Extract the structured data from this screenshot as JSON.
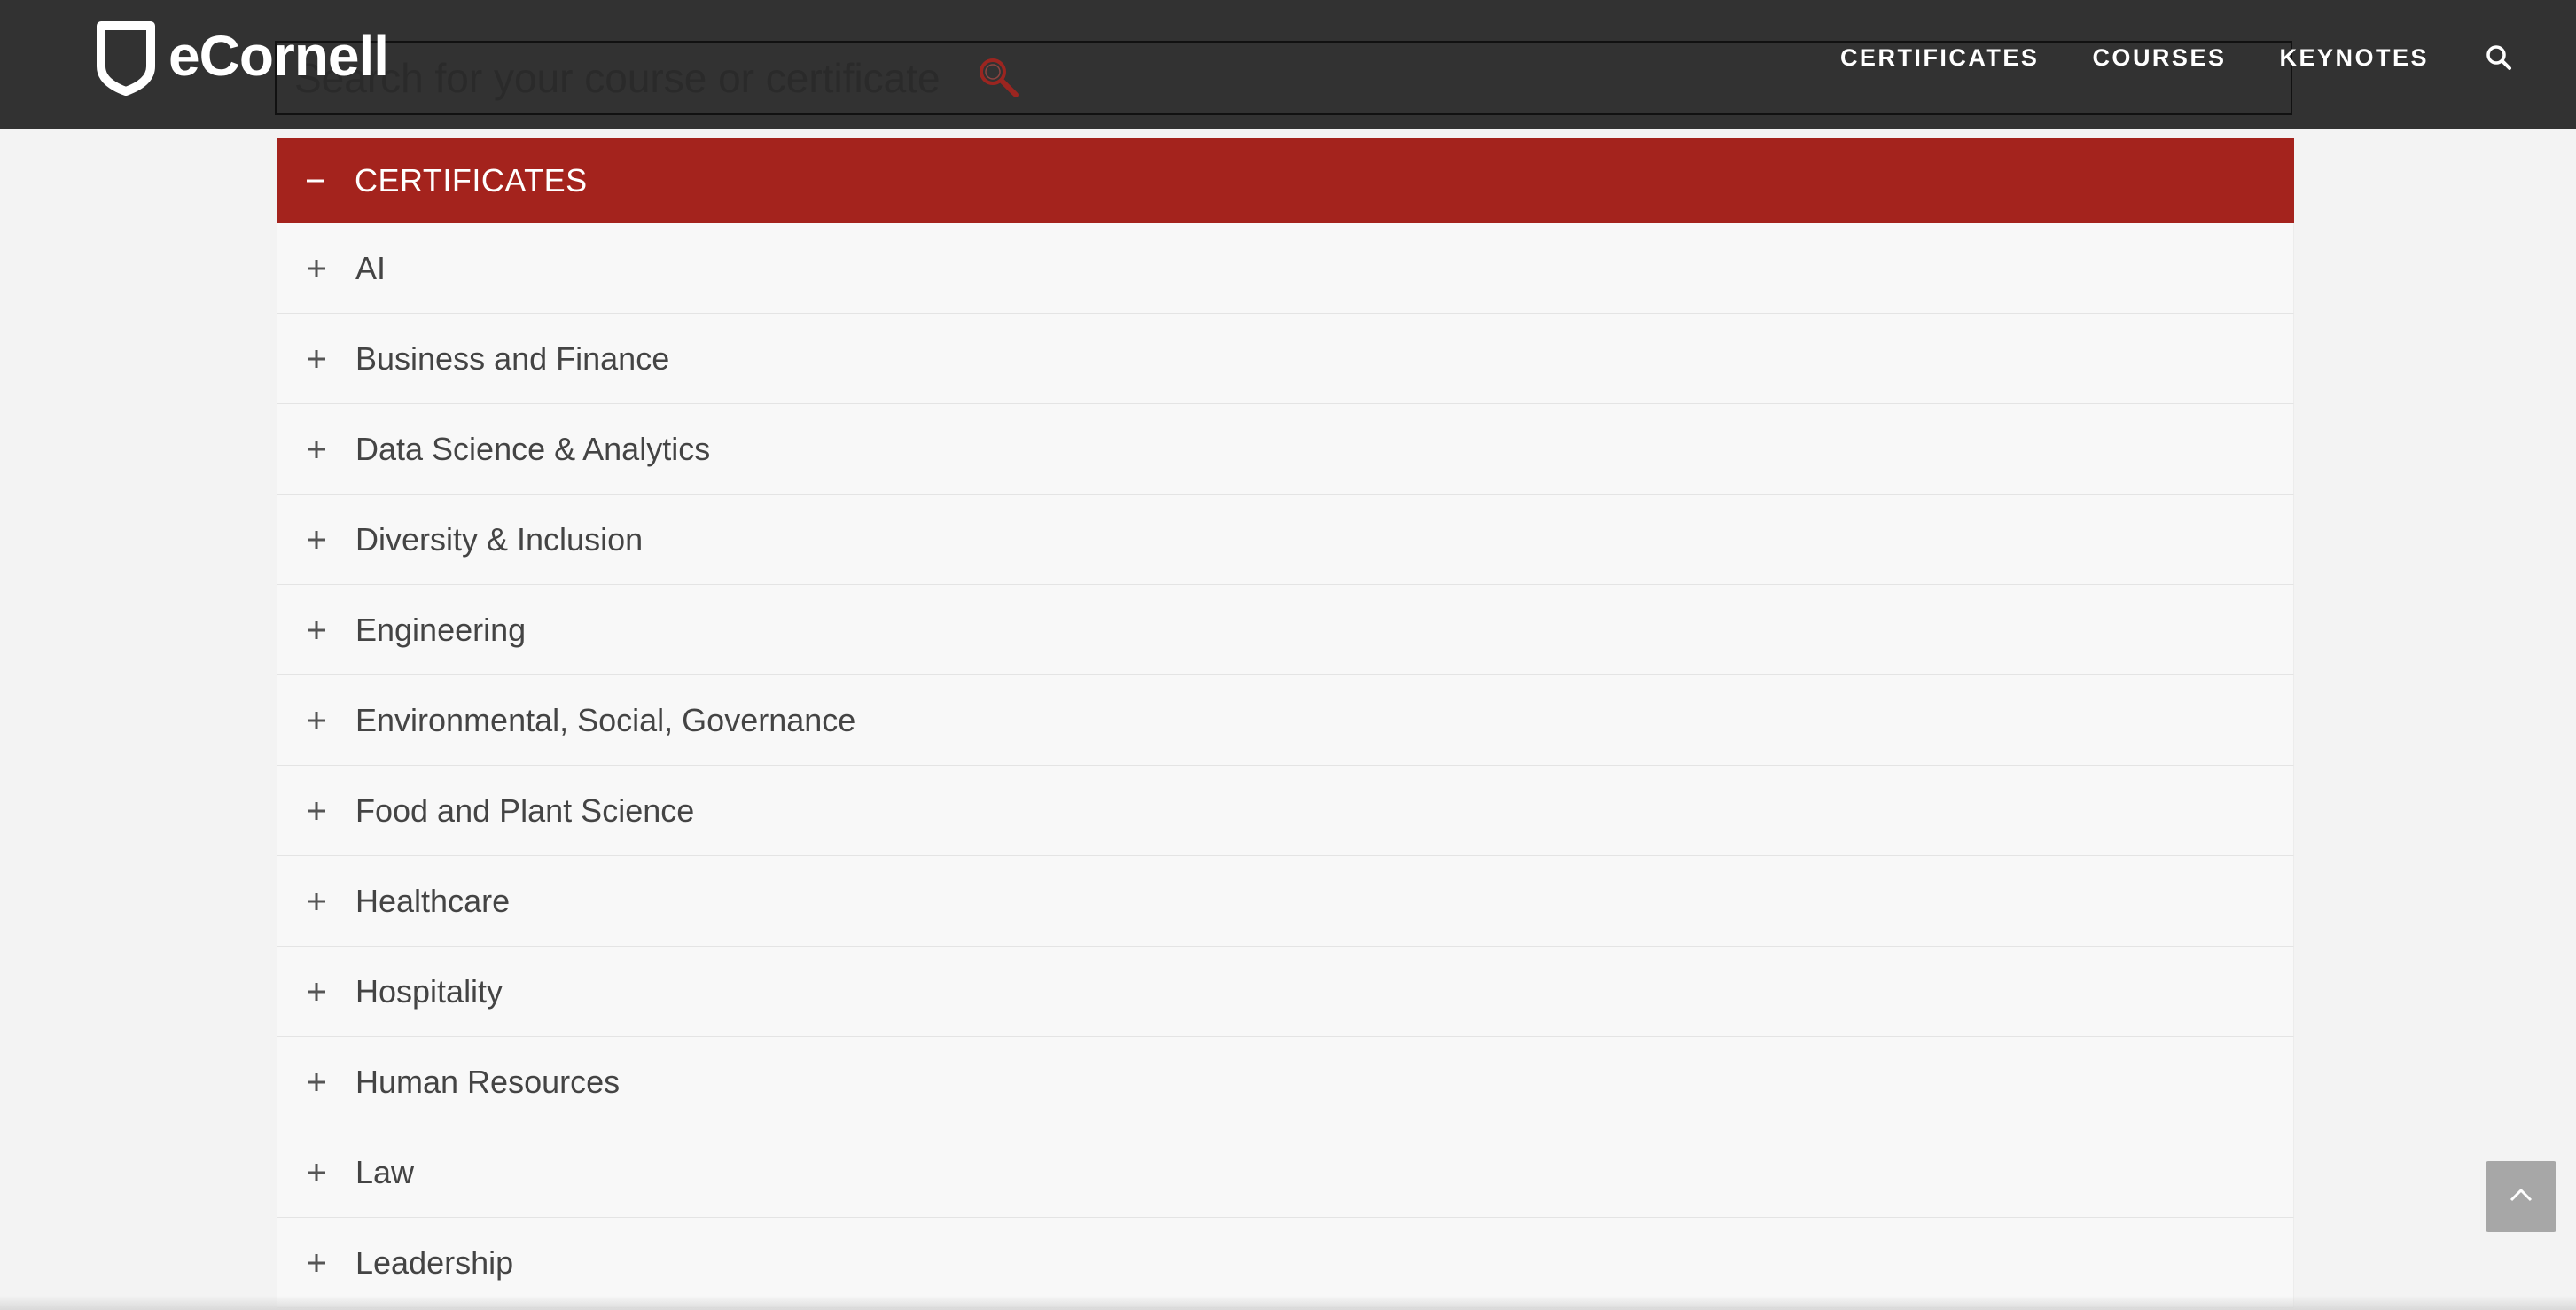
{
  "header": {
    "logo_text": "eCornell",
    "nav": [
      {
        "label": "CERTIFICATES"
      },
      {
        "label": "COURSES"
      },
      {
        "label": "KEYNOTES"
      }
    ]
  },
  "search": {
    "placeholder": "Search for your course or certificate"
  },
  "accordion": {
    "title": "CERTIFICATES",
    "expanded": true,
    "items": [
      {
        "label": "AI"
      },
      {
        "label": "Business and Finance"
      },
      {
        "label": "Data Science & Analytics"
      },
      {
        "label": "Diversity & Inclusion"
      },
      {
        "label": "Engineering"
      },
      {
        "label": "Environmental, Social, Governance"
      },
      {
        "label": "Food and Plant Science"
      },
      {
        "label": "Healthcare"
      },
      {
        "label": "Hospitality"
      },
      {
        "label": "Human Resources"
      },
      {
        "label": "Law"
      },
      {
        "label": "Leadership"
      }
    ]
  },
  "colors": {
    "header_bg": "#323232",
    "accent_red": "#a4231d",
    "row_bg": "#f8f8f8",
    "page_bg": "#f3f3f3"
  },
  "icons": {
    "logo": "shield-logo-icon",
    "nav_search": "search-icon",
    "search_glass": "magnifier-icon",
    "collapse": "minus-icon",
    "expand": "plus-icon",
    "back_to_top": "chevron-up-icon"
  }
}
